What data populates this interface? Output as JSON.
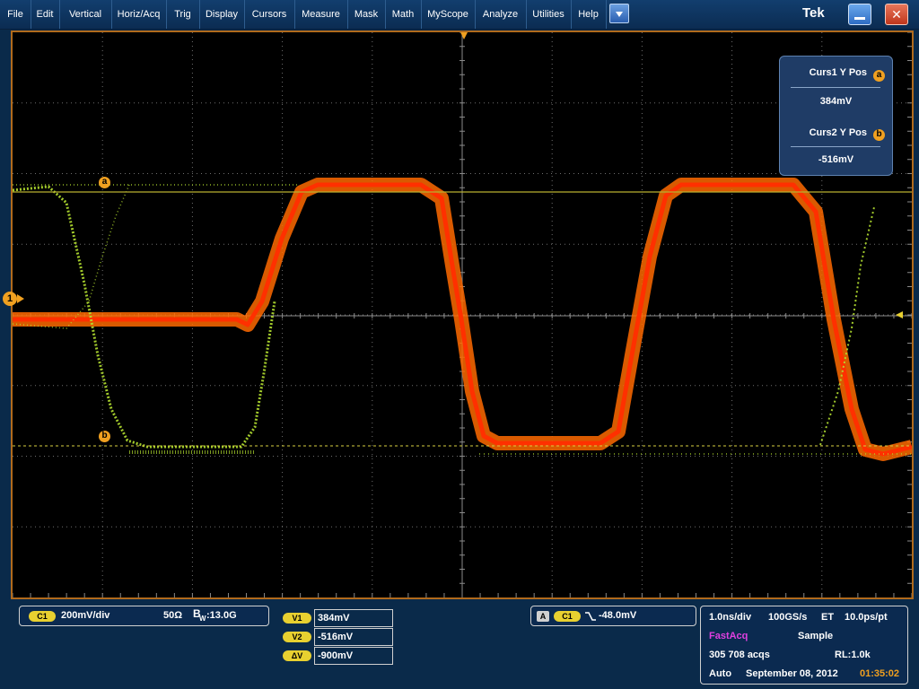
{
  "menu": {
    "items": [
      "File",
      "Edit",
      "Vertical",
      "Horiz/Acq",
      "Trig",
      "Display",
      "Cursors",
      "Measure",
      "Mask",
      "Math",
      "MyScope",
      "Analyze",
      "Utilities",
      "Help"
    ],
    "logo": "Tek",
    "close_glyph": "✕",
    "dropdown_icon": "chevron-down-icon"
  },
  "waveform": {
    "channel_marker": "1",
    "cursor_a_label": "a",
    "cursor_b_label": "b",
    "colors": {
      "grid": "#6e6e6e",
      "cursor_line": "#b8b030",
      "trace_sparse": "#b4e030",
      "trace_dense": "#ff6a00",
      "trace_hot": "#ff3000",
      "frame": "#b06a1c",
      "marker": "#f0a020"
    }
  },
  "cursor_readout": {
    "curs1_label": "Curs1 Y Pos",
    "curs1_badge": "a",
    "curs1_value": "384mV",
    "curs2_label": "Curs2 Y Pos",
    "curs2_badge": "b",
    "curs2_value": "-516mV"
  },
  "channel_panel": {
    "chip": "C1",
    "scale": "200mV/div",
    "impedance": "50Ω",
    "bandwidth_prefix": "B",
    "bandwidth_sub": "W",
    "bandwidth": ":13.0G"
  },
  "cursor_panel": {
    "v1_label": "V1",
    "v1_value": "384mV",
    "v2_label": "V2",
    "v2_value": "-516mV",
    "dv_label": "ΔV",
    "dv_value": "-900mV"
  },
  "trigger_panel": {
    "source_chip": "A",
    "channel_chip": "C1",
    "slope_icon": "falling-edge-icon",
    "level": "-48.0mV"
  },
  "acq_panel": {
    "timebase": "1.0ns/div",
    "sample_rate": "100GS/s",
    "mode": "ET",
    "resolution": "10.0ps/pt",
    "fastacq": "FastAcq",
    "sample": "Sample",
    "acqs": "305 708 acqs",
    "record_length": "RL:1.0k",
    "trigger_mode": "Auto",
    "date": "September 08, 2012",
    "time": "01:35:02"
  }
}
